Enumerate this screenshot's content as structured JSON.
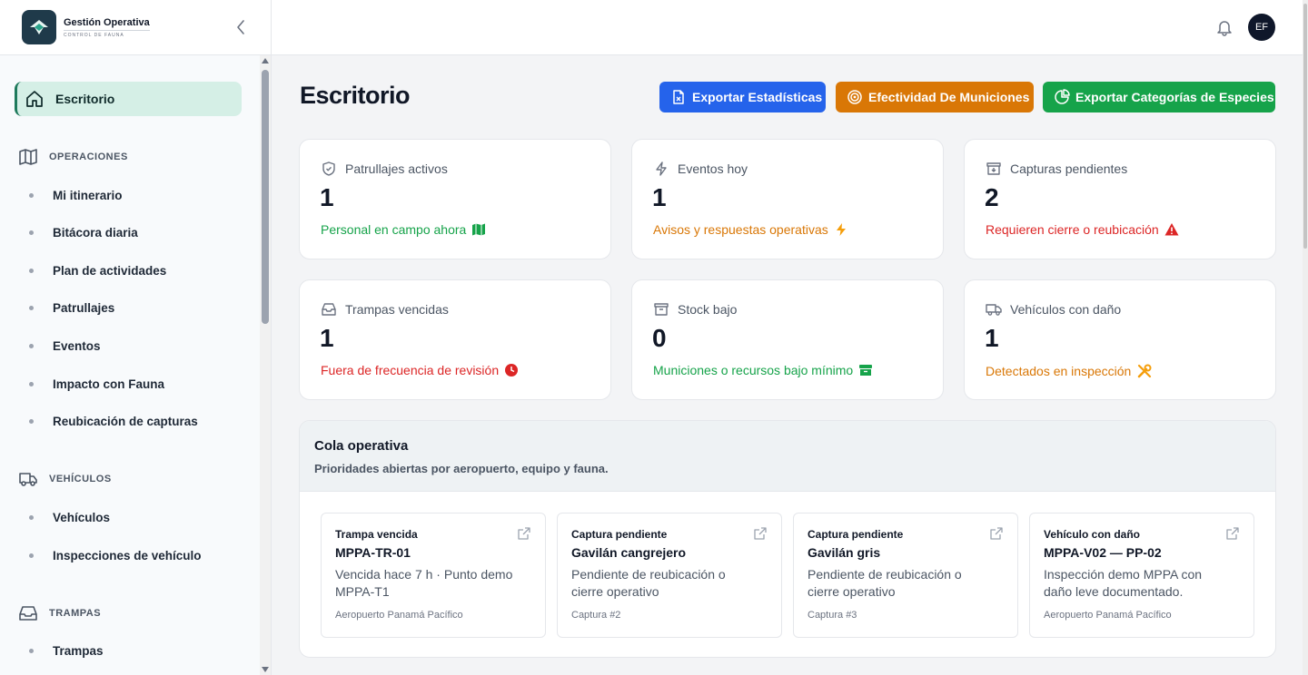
{
  "brand": {
    "title": "Gestión Operativa",
    "subtitle": "CONTROL DE FAUNA"
  },
  "nav": {
    "active": {
      "label": "Escritorio",
      "icon": "home-icon"
    },
    "sections": [
      {
        "label": "OPERACIONES",
        "icon": "map-icon",
        "items": [
          "Mi itinerario",
          "Bitácora diaria",
          "Plan de actividades",
          "Patrullajes",
          "Eventos",
          "Impacto con Fauna",
          "Reubicación de capturas"
        ]
      },
      {
        "label": "VEHÍCULOS",
        "icon": "truck-icon",
        "items": [
          "Vehículos",
          "Inspecciones de vehículo"
        ]
      },
      {
        "label": "TRAMPAS",
        "icon": "inbox-icon",
        "items": [
          "Trampas"
        ]
      }
    ]
  },
  "topbar": {
    "avatar": "EF"
  },
  "page": {
    "title": "Escritorio"
  },
  "actions": {
    "export_stats": "Exportar Estadísticas",
    "ammo_effectiveness": "Efectividad De Municiones",
    "export_species": "Exportar Categorías de Especies"
  },
  "colors": {
    "accent_green": "#16a34a",
    "accent_orange": "#d97706",
    "accent_red": "#dc2626",
    "accent_blue": "#2563eb"
  },
  "stats": [
    {
      "label": "Patrullajes activos",
      "value": "1",
      "note": "Personal en campo ahora",
      "icon": "shield-icon",
      "note_icon": "map-icon",
      "tone": "green"
    },
    {
      "label": "Eventos hoy",
      "value": "1",
      "note": "Avisos y respuestas operativas",
      "icon": "bolt-icon",
      "note_icon": "bolt-icon",
      "tone": "orange"
    },
    {
      "label": "Capturas pendientes",
      "value": "2",
      "note": "Requieren cierre o reubicación",
      "icon": "archive-icon",
      "note_icon": "warning-icon",
      "tone": "red"
    },
    {
      "label": "Trampas vencidas",
      "value": "1",
      "note": "Fuera de frecuencia de revisión",
      "icon": "inbox-icon",
      "note_icon": "clock-icon",
      "tone": "red"
    },
    {
      "label": "Stock bajo",
      "value": "0",
      "note": "Municiones o recursos bajo mínimo",
      "icon": "archive-icon",
      "note_icon": "archive-icon",
      "tone": "green"
    },
    {
      "label": "Vehículos con daño",
      "value": "1",
      "note": "Detectados en inspección",
      "icon": "truck-icon",
      "note_icon": "tools-icon",
      "tone": "orange"
    }
  ],
  "queue": {
    "title": "Cola operativa",
    "subtitle": "Prioridades abiertas por aeropuerto, equipo y fauna.",
    "items": [
      {
        "type": "Trampa vencida",
        "name": "MPPA-TR-01",
        "desc": "Vencida hace 7 h · Punto demo MPPA-T1",
        "meta": "Aeropuerto Panamá Pacífico"
      },
      {
        "type": "Captura pendiente",
        "name": "Gavilán cangrejero",
        "desc": "Pendiente de reubicación o cierre operativo",
        "meta": "Captura #2"
      },
      {
        "type": "Captura pendiente",
        "name": "Gavilán gris",
        "desc": "Pendiente de reubicación o cierre operativo",
        "meta": "Captura #3"
      },
      {
        "type": "Vehículo con daño",
        "name": "MPPA-V02 — PP-02",
        "desc": "Inspección demo MPPA con daño leve documentado.",
        "meta": "Aeropuerto Panamá Pacífico"
      }
    ]
  }
}
